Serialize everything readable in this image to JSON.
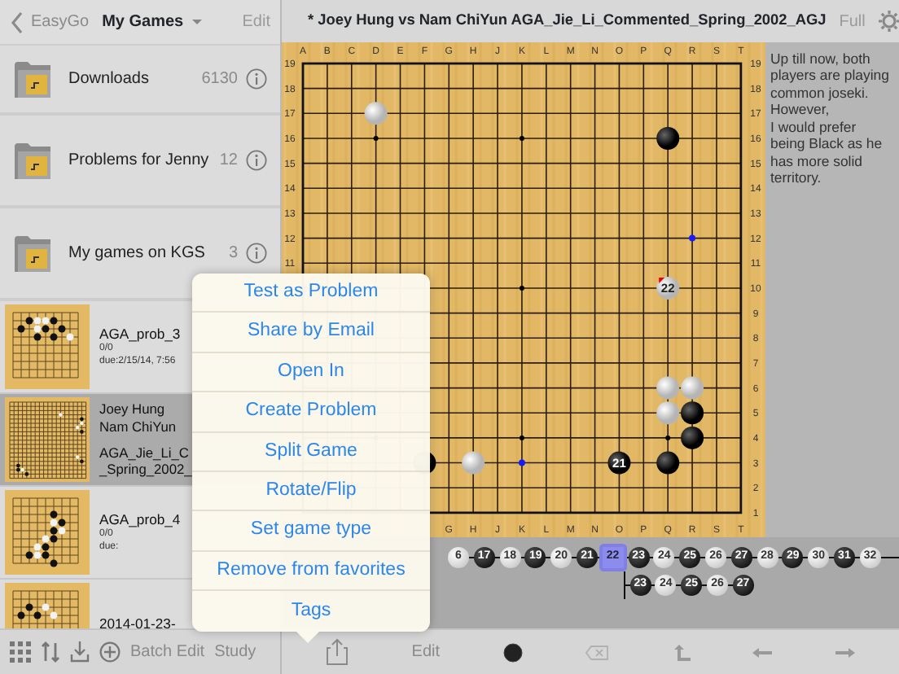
{
  "nav": {
    "back": "EasyGo",
    "title": "My Games",
    "edit": "Edit"
  },
  "folders": [
    {
      "name": "Downloads",
      "count": "6130"
    },
    {
      "name": "Problems for Jenny",
      "count": "12"
    },
    {
      "name": "My games on KGS",
      "count": "3"
    }
  ],
  "games": [
    {
      "selected": false,
      "lines": [
        {
          "kind": "title",
          "text": "AGA_prob_3"
        },
        {
          "kind": "small",
          "text": "0/0"
        },
        {
          "kind": "small",
          "text": "due:2/15/14, 7:56"
        }
      ]
    },
    {
      "selected": true,
      "lines": [
        {
          "kind": "player",
          "text": "Joey Hung"
        },
        {
          "kind": "player",
          "text": "Nam ChiYun"
        },
        {
          "kind": "gap",
          "text": "AGA_Jie_Li_C"
        },
        {
          "kind": "player",
          "text": "_Spring_2002_"
        }
      ]
    },
    {
      "selected": false,
      "lines": [
        {
          "kind": "title",
          "text": "AGA_prob_4"
        },
        {
          "kind": "small",
          "text": "0/0"
        },
        {
          "kind": "small",
          "text": "due:"
        }
      ]
    },
    {
      "selected": false,
      "lines": [
        {
          "kind": "title",
          "text": "2014-01-23-"
        }
      ]
    }
  ],
  "left_toolbar": {
    "batch_edit": "Batch Edit",
    "study": "Study"
  },
  "header": {
    "title": "* Joey Hung vs Nam ChiYun  AGA_Jie_Li_Commented_Spring_2002_AGJ",
    "full": "Full"
  },
  "board": {
    "top_labels": [
      "A",
      "B",
      "C",
      "D",
      "E",
      "F",
      "G",
      "H",
      "J",
      "K",
      "L",
      "M",
      "N",
      "O",
      "P",
      "Q",
      "R",
      "S",
      "T"
    ],
    "left_labels": [
      "19",
      "18",
      "17",
      "16",
      "15",
      "14",
      "13",
      "12",
      "11"
    ],
    "right_labels": [
      "19",
      "18",
      "17",
      "16",
      "15",
      "14",
      "13",
      "12",
      "11",
      "10",
      "9",
      "8",
      "7",
      "6",
      "5",
      "4",
      "3",
      "2",
      "1"
    ],
    "bottom_labels": [
      "G",
      "H",
      "J",
      "K",
      "L",
      "M",
      "N",
      "O",
      "P",
      "Q",
      "R",
      "S",
      "T"
    ],
    "grid": [
      [
        {
          "kind": "empty"
        },
        {
          "kind": "empty"
        },
        {
          "kind": "empty"
        },
        {
          "kind": "empty"
        },
        {
          "kind": "empty"
        },
        {
          "kind": "empty"
        },
        {
          "kind": "empty"
        },
        {
          "kind": "empty"
        },
        {
          "kind": "empty"
        },
        {
          "kind": "empty"
        },
        {
          "kind": "empty"
        },
        {
          "kind": "empty"
        },
        {
          "kind": "empty"
        },
        {
          "kind": "empty"
        },
        {
          "kind": "empty"
        },
        {
          "kind": "empty"
        },
        {
          "kind": "empty"
        },
        {
          "kind": "empty"
        },
        {
          "kind": "empty"
        }
      ],
      [
        {
          "kind": "empty"
        },
        {
          "kind": "empty"
        },
        {
          "kind": "empty"
        },
        {
          "kind": "empty"
        },
        {
          "kind": "empty"
        },
        {
          "kind": "empty"
        },
        {
          "kind": "empty"
        },
        {
          "kind": "empty"
        },
        {
          "kind": "empty"
        },
        {
          "kind": "empty"
        },
        {
          "kind": "empty"
        },
        {
          "kind": "empty"
        },
        {
          "kind": "empty"
        },
        {
          "kind": "empty"
        },
        {
          "kind": "empty"
        },
        {
          "kind": "empty"
        },
        {
          "kind": "empty"
        },
        {
          "kind": "empty"
        },
        {
          "kind": "empty"
        }
      ],
      [
        {
          "kind": "empty"
        },
        {
          "kind": "empty"
        },
        {
          "kind": "empty"
        },
        {
          "kind": "white"
        },
        {
          "kind": "empty"
        },
        {
          "kind": "empty"
        },
        {
          "kind": "empty"
        },
        {
          "kind": "empty"
        },
        {
          "kind": "empty"
        },
        {
          "kind": "empty"
        },
        {
          "kind": "empty"
        },
        {
          "kind": "empty"
        },
        {
          "kind": "empty"
        },
        {
          "kind": "empty"
        },
        {
          "kind": "empty"
        },
        {
          "kind": "empty"
        },
        {
          "kind": "empty"
        },
        {
          "kind": "empty"
        },
        {
          "kind": "empty"
        }
      ],
      [
        {
          "kind": "empty"
        },
        {
          "kind": "empty"
        },
        {
          "kind": "empty"
        },
        {
          "kind": "empty"
        },
        {
          "kind": "empty"
        },
        {
          "kind": "empty"
        },
        {
          "kind": "empty"
        },
        {
          "kind": "empty"
        },
        {
          "kind": "empty"
        },
        {
          "kind": "empty"
        },
        {
          "kind": "empty"
        },
        {
          "kind": "empty"
        },
        {
          "kind": "empty"
        },
        {
          "kind": "empty"
        },
        {
          "kind": "empty"
        },
        {
          "kind": "black"
        },
        {
          "kind": "empty"
        },
        {
          "kind": "empty"
        },
        {
          "kind": "empty"
        }
      ],
      [
        {
          "kind": "empty"
        },
        {
          "kind": "empty"
        },
        {
          "kind": "empty"
        },
        {
          "kind": "empty"
        },
        {
          "kind": "empty"
        },
        {
          "kind": "empty"
        },
        {
          "kind": "empty"
        },
        {
          "kind": "empty"
        },
        {
          "kind": "empty"
        },
        {
          "kind": "empty"
        },
        {
          "kind": "empty"
        },
        {
          "kind": "empty"
        },
        {
          "kind": "empty"
        },
        {
          "kind": "empty"
        },
        {
          "kind": "empty"
        },
        {
          "kind": "empty"
        },
        {
          "kind": "empty"
        },
        {
          "kind": "empty"
        },
        {
          "kind": "empty"
        }
      ],
      [
        {
          "kind": "empty"
        },
        {
          "kind": "empty"
        },
        {
          "kind": "empty"
        },
        {
          "kind": "empty"
        },
        {
          "kind": "empty"
        },
        {
          "kind": "empty"
        },
        {
          "kind": "empty"
        },
        {
          "kind": "empty"
        },
        {
          "kind": "empty"
        },
        {
          "kind": "empty"
        },
        {
          "kind": "empty"
        },
        {
          "kind": "empty"
        },
        {
          "kind": "empty"
        },
        {
          "kind": "empty"
        },
        {
          "kind": "empty"
        },
        {
          "kind": "empty"
        },
        {
          "kind": "empty"
        },
        {
          "kind": "empty"
        },
        {
          "kind": "empty"
        }
      ],
      [
        {
          "kind": "empty"
        },
        {
          "kind": "empty"
        },
        {
          "kind": "empty"
        },
        {
          "kind": "empty"
        },
        {
          "kind": "empty"
        },
        {
          "kind": "empty"
        },
        {
          "kind": "empty"
        },
        {
          "kind": "empty"
        },
        {
          "kind": "empty"
        },
        {
          "kind": "empty"
        },
        {
          "kind": "empty"
        },
        {
          "kind": "empty"
        },
        {
          "kind": "empty"
        },
        {
          "kind": "empty"
        },
        {
          "kind": "empty"
        },
        {
          "kind": "empty"
        },
        {
          "kind": "empty"
        },
        {
          "kind": "empty"
        },
        {
          "kind": "empty"
        }
      ],
      [
        {
          "kind": "empty"
        },
        {
          "kind": "empty"
        },
        {
          "kind": "empty"
        },
        {
          "kind": "empty"
        },
        {
          "kind": "empty"
        },
        {
          "kind": "empty"
        },
        {
          "kind": "empty"
        },
        {
          "kind": "empty"
        },
        {
          "kind": "empty"
        },
        {
          "kind": "empty"
        },
        {
          "kind": "empty"
        },
        {
          "kind": "empty"
        },
        {
          "kind": "empty"
        },
        {
          "kind": "empty"
        },
        {
          "kind": "empty"
        },
        {
          "kind": "empty"
        },
        {
          "kind": "blue-dot"
        },
        {
          "kind": "empty"
        },
        {
          "kind": "empty"
        }
      ],
      [
        {
          "kind": "empty"
        },
        {
          "kind": "empty"
        },
        {
          "kind": "empty"
        },
        {
          "kind": "empty"
        },
        {
          "kind": "empty"
        },
        {
          "kind": "empty"
        },
        {
          "kind": "empty"
        },
        {
          "kind": "empty"
        },
        {
          "kind": "empty"
        },
        {
          "kind": "empty"
        },
        {
          "kind": "empty"
        },
        {
          "kind": "empty"
        },
        {
          "kind": "empty"
        },
        {
          "kind": "empty"
        },
        {
          "kind": "empty"
        },
        {
          "kind": "empty"
        },
        {
          "kind": "empty"
        },
        {
          "kind": "empty"
        },
        {
          "kind": "empty"
        }
      ],
      [
        {
          "kind": "empty"
        },
        {
          "kind": "empty"
        },
        {
          "kind": "empty"
        },
        {
          "kind": "empty"
        },
        {
          "kind": "empty"
        },
        {
          "kind": "empty"
        },
        {
          "kind": "empty"
        },
        {
          "kind": "empty"
        },
        {
          "kind": "empty"
        },
        {
          "kind": "empty"
        },
        {
          "kind": "empty"
        },
        {
          "kind": "empty"
        },
        {
          "kind": "empty"
        },
        {
          "kind": "empty"
        },
        {
          "kind": "empty"
        },
        {
          "kind": "white-last",
          "label": "22"
        },
        {
          "kind": "empty"
        },
        {
          "kind": "empty"
        },
        {
          "kind": "empty"
        }
      ],
      [
        {
          "kind": "empty"
        },
        {
          "kind": "empty"
        },
        {
          "kind": "empty"
        },
        {
          "kind": "empty"
        },
        {
          "kind": "empty"
        },
        {
          "kind": "empty"
        },
        {
          "kind": "empty"
        },
        {
          "kind": "empty"
        },
        {
          "kind": "empty"
        },
        {
          "kind": "empty"
        },
        {
          "kind": "empty"
        },
        {
          "kind": "empty"
        },
        {
          "kind": "empty"
        },
        {
          "kind": "empty"
        },
        {
          "kind": "empty"
        },
        {
          "kind": "empty"
        },
        {
          "kind": "empty"
        },
        {
          "kind": "empty"
        },
        {
          "kind": "empty"
        }
      ],
      [
        {
          "kind": "empty"
        },
        {
          "kind": "empty"
        },
        {
          "kind": "empty"
        },
        {
          "kind": "empty"
        },
        {
          "kind": "empty"
        },
        {
          "kind": "empty"
        },
        {
          "kind": "empty"
        },
        {
          "kind": "empty"
        },
        {
          "kind": "empty"
        },
        {
          "kind": "empty"
        },
        {
          "kind": "empty"
        },
        {
          "kind": "empty"
        },
        {
          "kind": "empty"
        },
        {
          "kind": "empty"
        },
        {
          "kind": "empty"
        },
        {
          "kind": "empty"
        },
        {
          "kind": "empty"
        },
        {
          "kind": "empty"
        },
        {
          "kind": "empty"
        }
      ],
      [
        {
          "kind": "empty"
        },
        {
          "kind": "empty"
        },
        {
          "kind": "empty"
        },
        {
          "kind": "empty"
        },
        {
          "kind": "empty"
        },
        {
          "kind": "empty"
        },
        {
          "kind": "empty"
        },
        {
          "kind": "empty"
        },
        {
          "kind": "empty"
        },
        {
          "kind": "empty"
        },
        {
          "kind": "empty"
        },
        {
          "kind": "empty"
        },
        {
          "kind": "empty"
        },
        {
          "kind": "empty"
        },
        {
          "kind": "empty"
        },
        {
          "kind": "empty"
        },
        {
          "kind": "empty"
        },
        {
          "kind": "empty"
        },
        {
          "kind": "empty"
        }
      ],
      [
        {
          "kind": "empty"
        },
        {
          "kind": "empty"
        },
        {
          "kind": "empty"
        },
        {
          "kind": "empty"
        },
        {
          "kind": "empty"
        },
        {
          "kind": "empty"
        },
        {
          "kind": "empty"
        },
        {
          "kind": "empty"
        },
        {
          "kind": "empty"
        },
        {
          "kind": "empty"
        },
        {
          "kind": "empty"
        },
        {
          "kind": "empty"
        },
        {
          "kind": "empty"
        },
        {
          "kind": "empty"
        },
        {
          "kind": "empty"
        },
        {
          "kind": "white"
        },
        {
          "kind": "white"
        },
        {
          "kind": "empty"
        },
        {
          "kind": "empty"
        }
      ],
      [
        {
          "kind": "empty"
        },
        {
          "kind": "empty"
        },
        {
          "kind": "empty"
        },
        {
          "kind": "empty"
        },
        {
          "kind": "empty"
        },
        {
          "kind": "empty"
        },
        {
          "kind": "empty"
        },
        {
          "kind": "empty"
        },
        {
          "kind": "empty"
        },
        {
          "kind": "empty"
        },
        {
          "kind": "empty"
        },
        {
          "kind": "empty"
        },
        {
          "kind": "empty"
        },
        {
          "kind": "empty"
        },
        {
          "kind": "empty"
        },
        {
          "kind": "white"
        },
        {
          "kind": "black"
        },
        {
          "kind": "empty"
        },
        {
          "kind": "empty"
        }
      ],
      [
        {
          "kind": "empty"
        },
        {
          "kind": "empty"
        },
        {
          "kind": "empty"
        },
        {
          "kind": "empty"
        },
        {
          "kind": "empty"
        },
        {
          "kind": "empty"
        },
        {
          "kind": "empty"
        },
        {
          "kind": "empty"
        },
        {
          "kind": "empty"
        },
        {
          "kind": "empty"
        },
        {
          "kind": "empty"
        },
        {
          "kind": "empty"
        },
        {
          "kind": "empty"
        },
        {
          "kind": "empty"
        },
        {
          "kind": "empty"
        },
        {
          "kind": "empty"
        },
        {
          "kind": "black"
        },
        {
          "kind": "empty"
        },
        {
          "kind": "empty"
        }
      ],
      [
        {
          "kind": "empty"
        },
        {
          "kind": "empty"
        },
        {
          "kind": "empty"
        },
        {
          "kind": "empty"
        },
        {
          "kind": "empty"
        },
        {
          "kind": "black"
        },
        {
          "kind": "empty"
        },
        {
          "kind": "white"
        },
        {
          "kind": "empty"
        },
        {
          "kind": "blue-dot"
        },
        {
          "kind": "empty"
        },
        {
          "kind": "empty"
        },
        {
          "kind": "empty"
        },
        {
          "kind": "black",
          "label": "21"
        },
        {
          "kind": "empty"
        },
        {
          "kind": "black"
        },
        {
          "kind": "empty"
        },
        {
          "kind": "empty"
        },
        {
          "kind": "empty"
        }
      ],
      [
        {
          "kind": "empty"
        },
        {
          "kind": "empty"
        },
        {
          "kind": "empty"
        },
        {
          "kind": "empty"
        },
        {
          "kind": "empty"
        },
        {
          "kind": "empty"
        },
        {
          "kind": "empty"
        },
        {
          "kind": "empty"
        },
        {
          "kind": "empty"
        },
        {
          "kind": "empty"
        },
        {
          "kind": "empty"
        },
        {
          "kind": "empty"
        },
        {
          "kind": "empty"
        },
        {
          "kind": "empty"
        },
        {
          "kind": "empty"
        },
        {
          "kind": "empty"
        },
        {
          "kind": "empty"
        },
        {
          "kind": "empty"
        },
        {
          "kind": "empty"
        }
      ],
      [
        {
          "kind": "empty"
        },
        {
          "kind": "empty"
        },
        {
          "kind": "empty"
        },
        {
          "kind": "empty"
        },
        {
          "kind": "empty"
        },
        {
          "kind": "empty"
        },
        {
          "kind": "empty"
        },
        {
          "kind": "empty"
        },
        {
          "kind": "empty"
        },
        {
          "kind": "empty"
        },
        {
          "kind": "empty"
        },
        {
          "kind": "empty"
        },
        {
          "kind": "empty"
        },
        {
          "kind": "empty"
        },
        {
          "kind": "empty"
        },
        {
          "kind": "empty"
        },
        {
          "kind": "empty"
        },
        {
          "kind": "empty"
        },
        {
          "kind": "empty"
        }
      ]
    ]
  },
  "comment": "Up till now, both players are playing common joseki. However,\nI would prefer being Black as he has more solid territory.",
  "tree": {
    "moves": [
      {
        "label": "6",
        "kind": "white",
        "selected": false
      },
      {
        "label": "17",
        "kind": "black",
        "selected": false
      },
      {
        "label": "18",
        "kind": "white",
        "selected": false
      },
      {
        "label": "19",
        "kind": "black",
        "selected": false
      },
      {
        "label": "20",
        "kind": "white",
        "selected": false
      },
      {
        "label": "21",
        "kind": "black",
        "selected": false
      },
      {
        "label": "22",
        "kind": "white",
        "selected": true,
        "children": [
          {
            "label": "23",
            "kind": "black",
            "selected": false
          },
          {
            "label": "24",
            "kind": "white",
            "selected": false
          },
          {
            "label": "25",
            "kind": "black",
            "selected": false
          },
          {
            "label": "26",
            "kind": "white",
            "selected": false
          },
          {
            "label": "27",
            "kind": "black",
            "selected": false
          }
        ]
      },
      {
        "label": "23",
        "kind": "black",
        "selected": false
      },
      {
        "label": "24",
        "kind": "white",
        "selected": false
      },
      {
        "label": "25",
        "kind": "black",
        "selected": false
      },
      {
        "label": "26",
        "kind": "white",
        "selected": false
      },
      {
        "label": "27",
        "kind": "black",
        "selected": false
      },
      {
        "label": "28",
        "kind": "white",
        "selected": false
      },
      {
        "label": "29",
        "kind": "black",
        "selected": false
      },
      {
        "label": "30",
        "kind": "white",
        "selected": false
      },
      {
        "label": "31",
        "kind": "black",
        "selected": false
      },
      {
        "label": "32",
        "kind": "white",
        "selected": false
      }
    ]
  },
  "right_toolbar": {
    "edit": "Edit",
    "next_stone": {
      "kind": "black"
    },
    "delete_disabled": true
  },
  "menu": [
    "Test as Problem",
    "Share by Email",
    "Open In",
    "Create Problem",
    "Split Game",
    "Rotate/Flip",
    "Set game type",
    "Remove from favorites",
    "Tags"
  ]
}
